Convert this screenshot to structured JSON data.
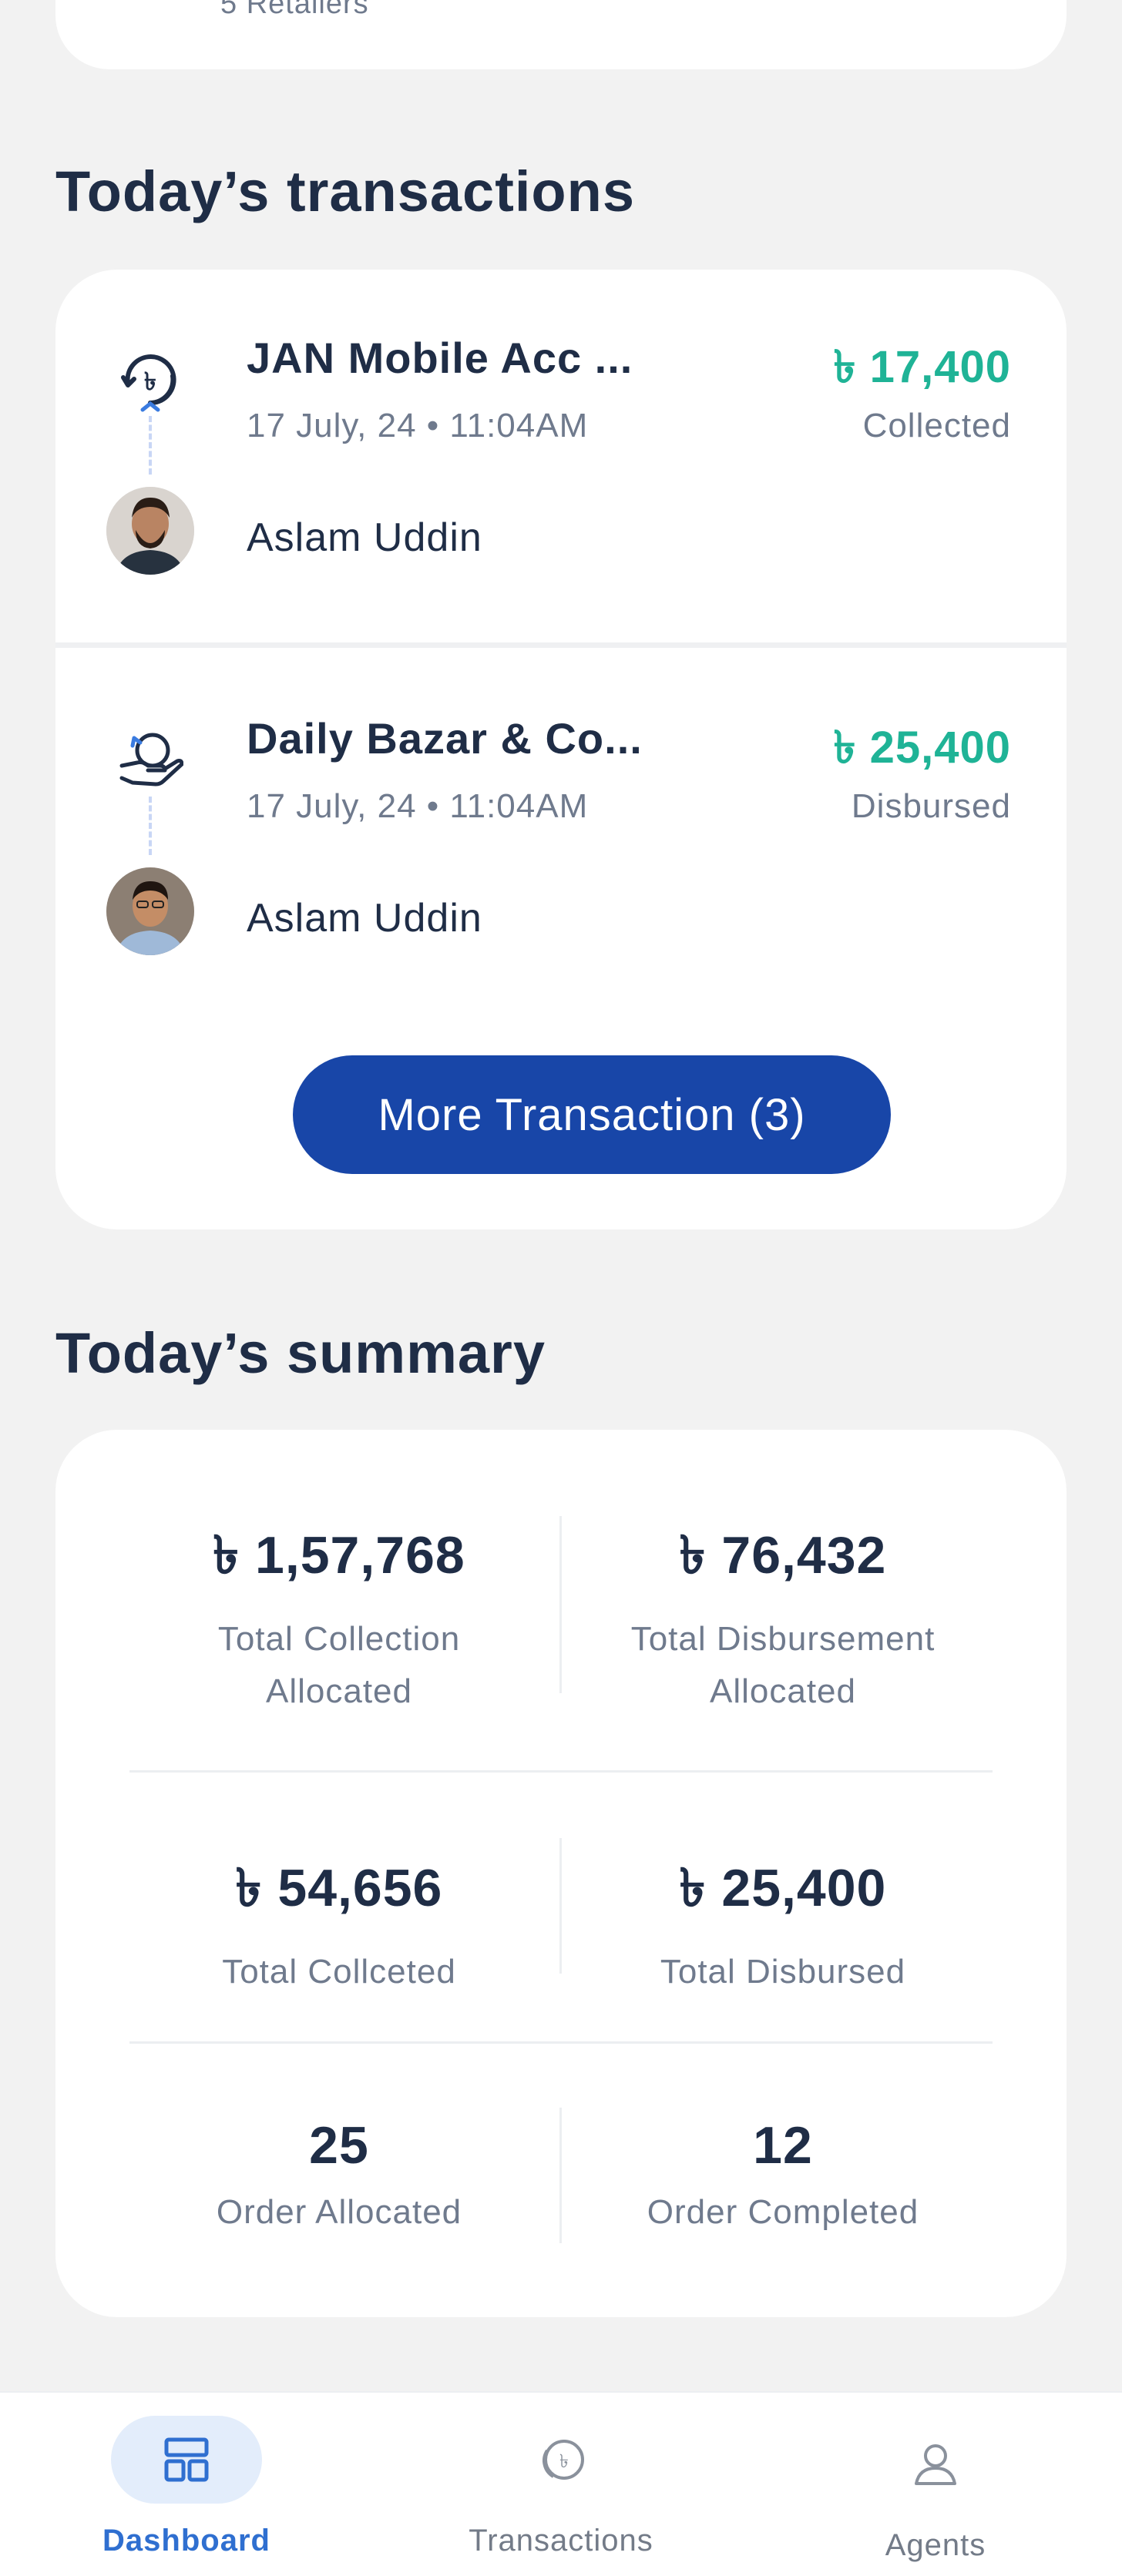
{
  "top_card": {
    "subtitle": "5 Retailers"
  },
  "transactions_section": {
    "title": "Today’s transactions",
    "items": [
      {
        "name": "JAN Mobile Acc ...",
        "date": "17 July, 24 • 11:04AM",
        "person": "Aslam Uddin",
        "amount": "৳ 17,400",
        "status": "Collected",
        "icon": "taka-sync-icon"
      },
      {
        "name": "Daily Bazar & Co...",
        "date": "17 July, 24 • 11:04AM",
        "person": "Aslam Uddin",
        "amount": "৳ 25,400",
        "status": "Disbursed",
        "icon": "hand-coin-icon"
      }
    ],
    "more_button_label": "More Transaction (3)"
  },
  "summary_section": {
    "title": "Today’s summary",
    "rows": [
      [
        {
          "value": "৳ 1,57,768",
          "label_line1": "Total Collection",
          "label_line2": "Allocated"
        },
        {
          "value": "৳ 76,432",
          "label_line1": "Total Disbursement",
          "label_line2": "Allocated"
        }
      ],
      [
        {
          "value": "৳ 54,656",
          "label_line1": "Total Collceted",
          "label_line2": ""
        },
        {
          "value": "৳ 25,400",
          "label_line1": "Total Disbursed",
          "label_line2": ""
        }
      ],
      [
        {
          "value": "25",
          "label_line1": "Order Allocated",
          "label_line2": ""
        },
        {
          "value": "12",
          "label_line1": "Order Completed",
          "label_line2": ""
        }
      ]
    ]
  },
  "bottom_nav": {
    "items": [
      {
        "label": "Dashboard",
        "icon": "dashboard-icon",
        "active": true
      },
      {
        "label": "Transactions",
        "icon": "coins-icon",
        "active": false
      },
      {
        "label": "Agents",
        "icon": "agents-icon",
        "active": false
      }
    ]
  },
  "colors": {
    "background": "#f2f2f2",
    "card": "#ffffff",
    "primary": "#1846a8",
    "positive": "#1fb396",
    "text_dark": "#1f2d46",
    "text_muted": "#6f7a8d",
    "nav_active": "#2f6fd0",
    "nav_active_bg": "#e3edfb"
  }
}
